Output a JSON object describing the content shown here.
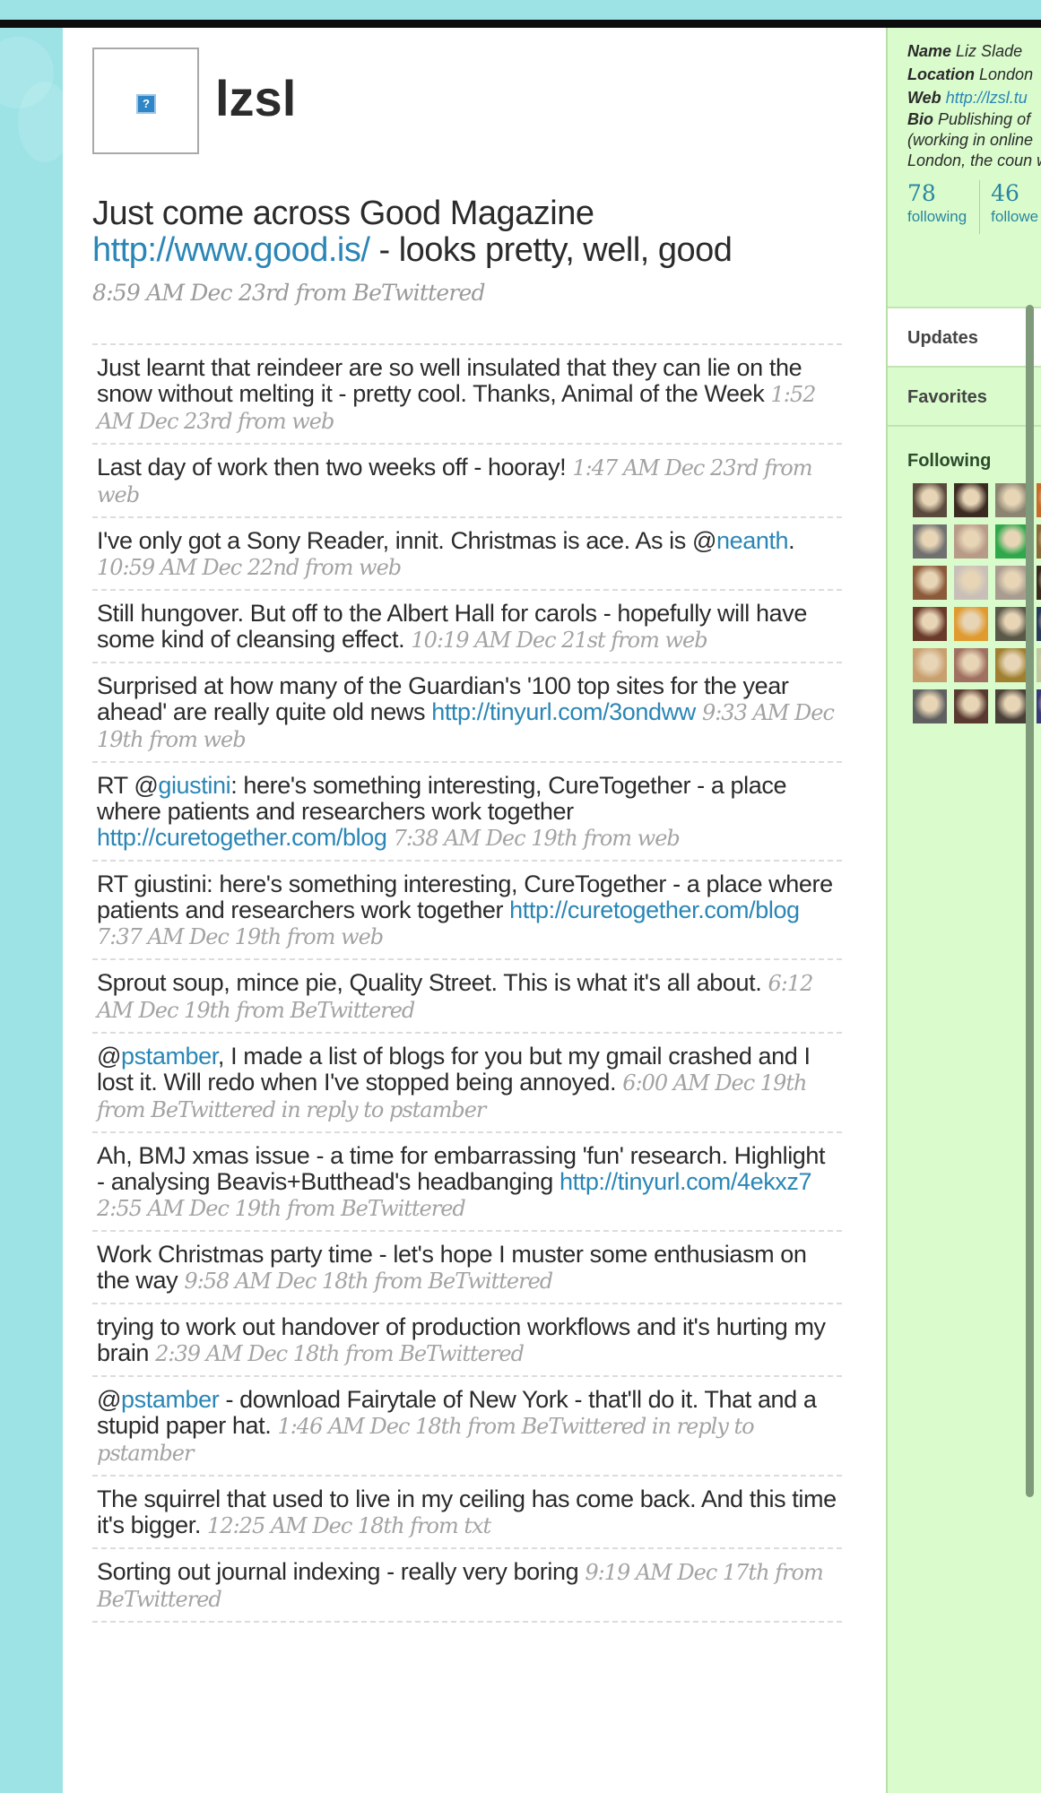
{
  "user": {
    "screen_name": "lzsl",
    "avatar_icon": "broken-image-icon"
  },
  "latest_tweet": {
    "text_before": "Just come across Good Magazine ",
    "link": "http://www.good.is/",
    "text_after": " - looks pretty, well, good",
    "meta": "8:59 AM Dec 23rd from BeTwittered"
  },
  "tweets": [
    {
      "parts": [
        {
          "t": "Just learnt that reindeer are so well insulated that they can lie on the snow without melting it - pretty cool. Thanks, Animal of the Week"
        }
      ],
      "meta": "1:52 AM Dec 23rd from web"
    },
    {
      "parts": [
        {
          "t": "Last day of work then two weeks off - hooray!"
        }
      ],
      "meta": "1:47 AM Dec 23rd from web"
    },
    {
      "parts": [
        {
          "t": "I've only got a Sony Reader, innit. Christmas is ace. As is @"
        },
        {
          "link": "neanth"
        },
        {
          "t": "."
        }
      ],
      "meta": "10:59 AM Dec 22nd from web"
    },
    {
      "parts": [
        {
          "t": "Still hungover. But off to the Albert Hall for carols - hopefully will have some kind of cleansing effect."
        }
      ],
      "meta": "10:19 AM Dec 21st from web"
    },
    {
      "parts": [
        {
          "t": "Surprised at how many of the Guardian's '100 top sites for the year ahead' are really quite old news "
        },
        {
          "link": "http://tinyurl.com/3ondww"
        }
      ],
      "meta": "9:33 AM Dec 19th from web"
    },
    {
      "parts": [
        {
          "t": "RT @"
        },
        {
          "link": "giustini"
        },
        {
          "t": ": here's something interesting, CureTogether - a place where patients and researchers work together "
        },
        {
          "link": "http://curetogether.com/blog"
        }
      ],
      "meta": "7:38 AM Dec 19th from web"
    },
    {
      "parts": [
        {
          "t": "RT giustini: here's something interesting, CureTogether - a place where patients and researchers work together "
        },
        {
          "link": "http://curetogether.com/blog"
        }
      ],
      "meta": "7:37 AM Dec 19th from web"
    },
    {
      "parts": [
        {
          "t": "Sprout soup, mince pie, Quality Street. This is what it's all about."
        }
      ],
      "meta": "6:12 AM Dec 19th from BeTwittered"
    },
    {
      "parts": [
        {
          "t": "@"
        },
        {
          "link": "pstamber"
        },
        {
          "t": ", I made a list of blogs for you but my gmail crashed and I lost it. Will redo when I've stopped being annoyed."
        }
      ],
      "meta": "6:00 AM Dec 19th from BeTwittered in reply to pstamber"
    },
    {
      "parts": [
        {
          "t": "Ah, BMJ xmas issue - a time for embarrassing 'fun' research. Highlight - analysing Beavis+Butthead's headbanging "
        },
        {
          "link": "http://tinyurl.com/4ekxz7"
        }
      ],
      "meta": "2:55 AM Dec 19th from BeTwittered"
    },
    {
      "parts": [
        {
          "t": "Work Christmas party time - let's hope I muster some enthusiasm on the way"
        }
      ],
      "meta": "9:58 AM Dec 18th from BeTwittered"
    },
    {
      "parts": [
        {
          "t": "trying to work out handover of production workflows and it's hurting my brain"
        }
      ],
      "meta": "2:39 AM Dec 18th from BeTwittered"
    },
    {
      "parts": [
        {
          "t": "@"
        },
        {
          "link": "pstamber"
        },
        {
          "t": " - download Fairytale of New York - that'll do it. That and a stupid paper hat."
        }
      ],
      "meta": "1:46 AM Dec 18th from BeTwittered in reply to pstamber"
    },
    {
      "parts": [
        {
          "t": "The squirrel that used to live in my ceiling has come back. And this time it's bigger."
        }
      ],
      "meta": "12:25 AM Dec 18th from txt"
    },
    {
      "parts": [
        {
          "t": "Sorting out journal indexing - really very boring"
        }
      ],
      "meta": "9:19 AM Dec 17th from BeTwittered"
    }
  ],
  "sidebar": {
    "profile": {
      "name_label": "Name",
      "name_value": "Liz Slade",
      "location_label": "Location",
      "location_value": "London",
      "web_label": "Web",
      "web_value": "http://lzsl.tu",
      "bio_label": "Bio",
      "bio_value": "Publishing of (working in online London, the coun world"
    },
    "stats": {
      "following_count": "78",
      "following_label": "following",
      "followers_count": "46",
      "followers_label": "followe"
    },
    "nav": {
      "updates": "Updates",
      "favorites": "Favorites"
    },
    "following_title": "Following",
    "following_avatars": [
      "#5a4a3e",
      "#3b2a22",
      "#8a8470",
      "#c86a2a",
      "#707070",
      "#b79a88",
      "#2ea84a",
      "#8a6a3a",
      "#8a5a3a",
      "#c8c0b8",
      "#a89c90",
      "#3a2a20",
      "#6a3a2a",
      "#e09a30",
      "#5a5848",
      "#2a3a5a",
      "#c8a070",
      "#a07060",
      "#a08030",
      "#c0c8a0",
      "#606060",
      "#5a3a30",
      "#4a4038",
      "#3a3a7a"
    ]
  },
  "colors": {
    "link": "#2a86b6",
    "background": "#9de3e6",
    "sidebar": "#dafccc"
  }
}
